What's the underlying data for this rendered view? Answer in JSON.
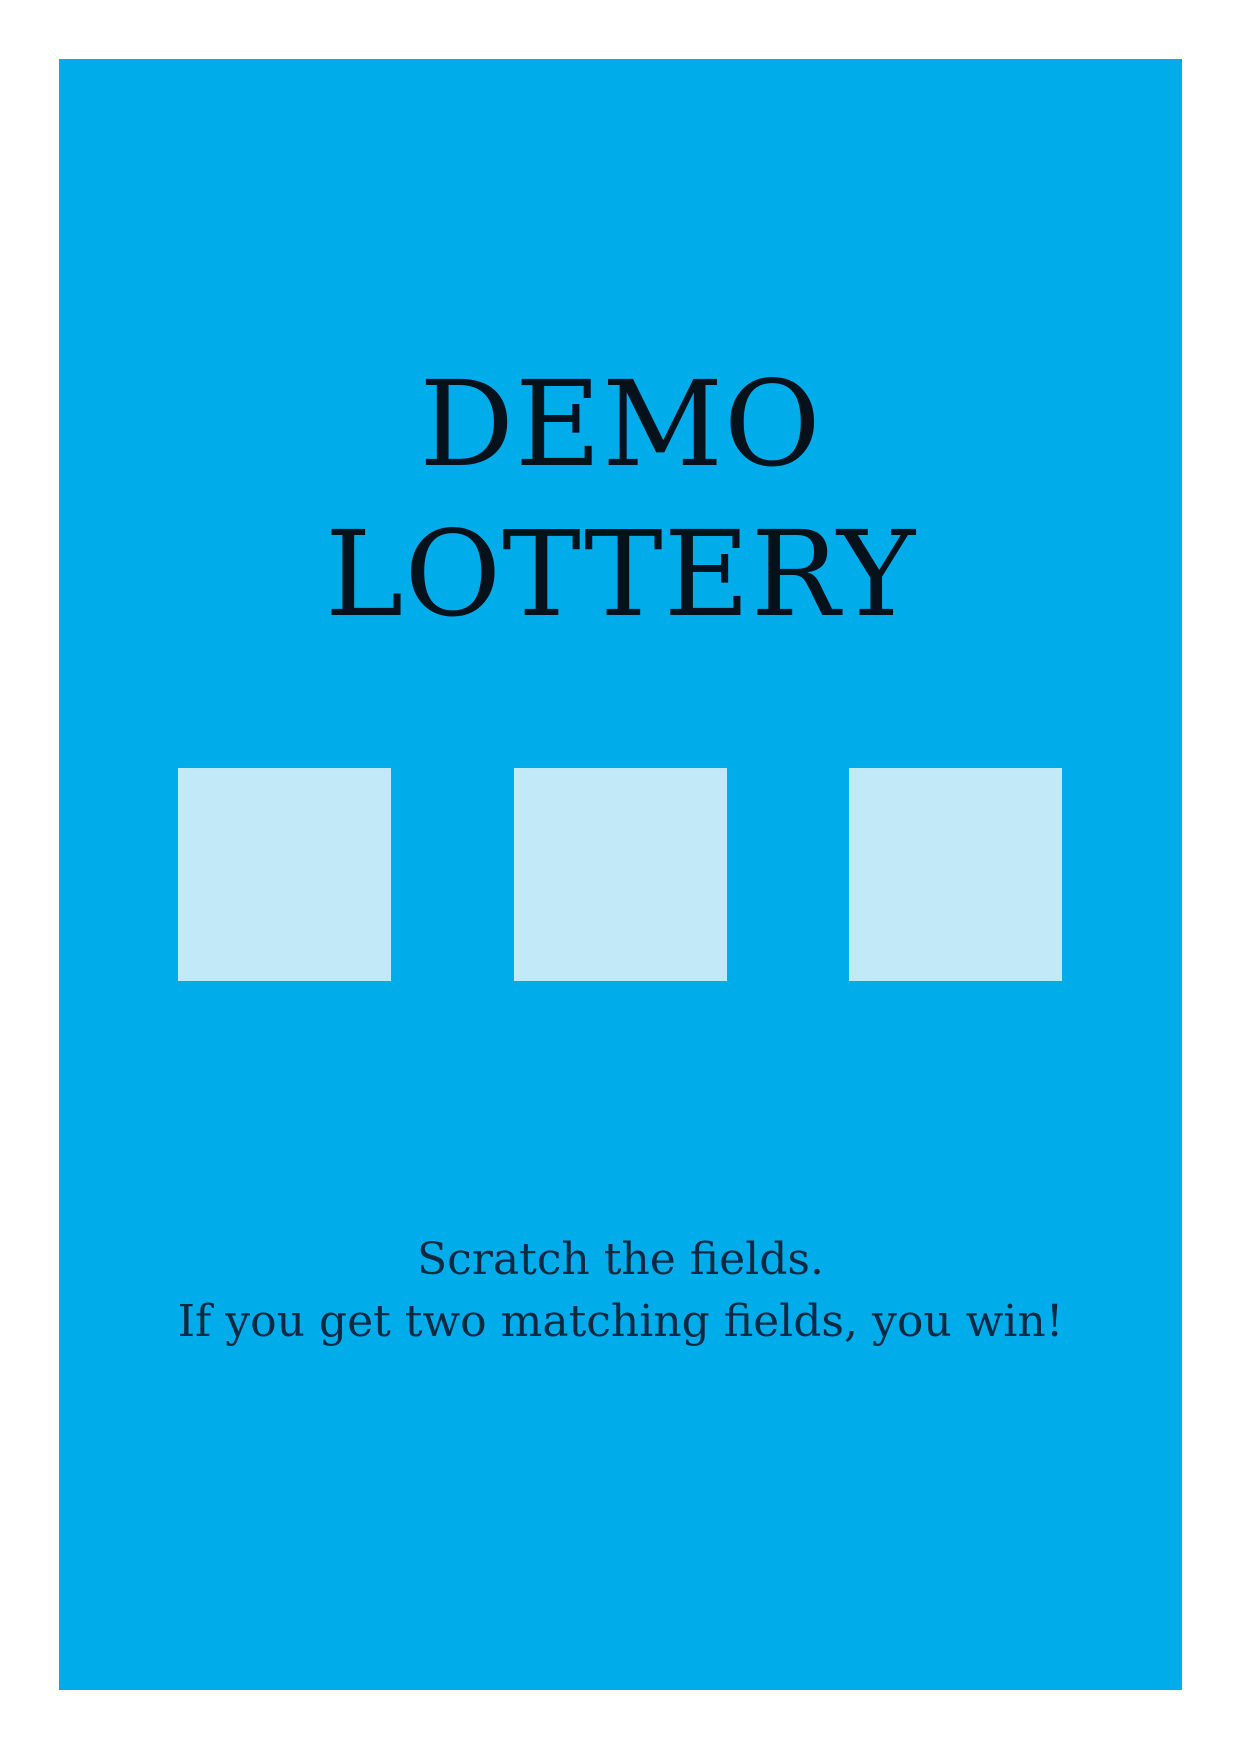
{
  "ticket": {
    "background_color": "#00adea",
    "field_color": "#c1e9f8",
    "title_lines": [
      "DEMO",
      "LOTTERY"
    ],
    "fields": [
      {
        "state": "unscratched"
      },
      {
        "state": "unscratched"
      },
      {
        "state": "unscratched"
      }
    ],
    "instructions": {
      "line1": "Scratch the fields.",
      "line2": "If you get two matching fields, you win!"
    }
  }
}
